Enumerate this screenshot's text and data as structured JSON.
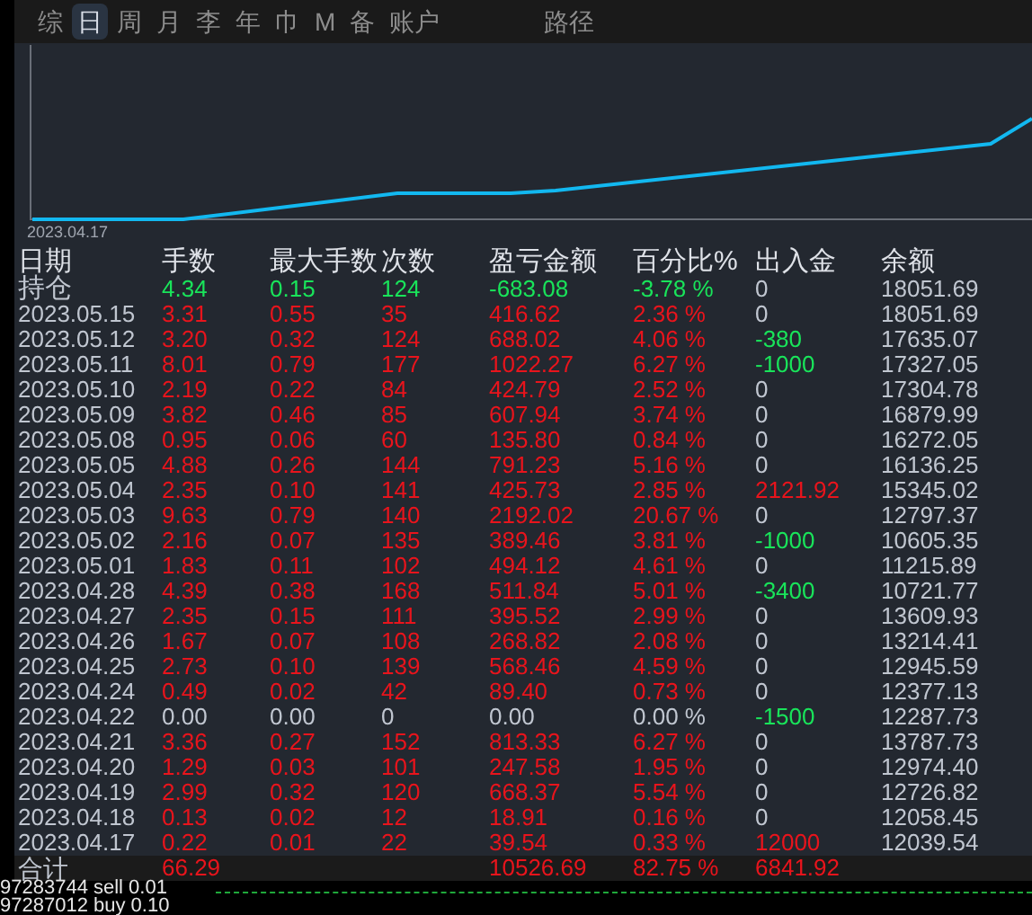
{
  "tabs": [
    {
      "label": "综",
      "selected": false
    },
    {
      "label": "日",
      "selected": true
    },
    {
      "label": "周",
      "selected": false
    },
    {
      "label": "月",
      "selected": false
    },
    {
      "label": "李",
      "selected": false
    },
    {
      "label": "年",
      "selected": false
    },
    {
      "label": "巾",
      "selected": false
    },
    {
      "label": "M",
      "selected": false
    },
    {
      "label": "备",
      "selected": false
    },
    {
      "label": "账户",
      "selected": false
    }
  ],
  "path_tab": {
    "label": "路径",
    "selected": false
  },
  "equity_chart": {
    "start_label": "2023.04.17"
  },
  "table": {
    "columns": [
      "日期",
      "手数",
      "最大手数",
      "次数",
      "盈亏金额",
      "百分比%",
      "出入金",
      "余额"
    ],
    "rows": [
      {
        "date": "持仓",
        "lots": "4.34",
        "max_lots": "0.15",
        "count": "124",
        "pnl": "-683.08",
        "pct": "-3.78 %",
        "flow": {
          "value": "0",
          "color": "#c0c6d0"
        },
        "balance": "18051.69",
        "color": "#19e45a"
      },
      {
        "date": "2023.05.15",
        "lots": "3.31",
        "max_lots": "0.55",
        "count": "35",
        "pnl": "416.62",
        "pct": "2.36 %",
        "flow": {
          "value": "0",
          "color": "#c0c6d0"
        },
        "balance": "18051.69",
        "color": "#e8141c"
      },
      {
        "date": "2023.05.12",
        "lots": "3.20",
        "max_lots": "0.32",
        "count": "124",
        "pnl": "688.02",
        "pct": "4.06 %",
        "flow": {
          "value": "-380",
          "color": "#19e45a"
        },
        "balance": "17635.07",
        "color": "#e8141c"
      },
      {
        "date": "2023.05.11",
        "lots": "8.01",
        "max_lots": "0.79",
        "count": "177",
        "pnl": "1022.27",
        "pct": "6.27 %",
        "flow": {
          "value": "-1000",
          "color": "#19e45a"
        },
        "balance": "17327.05",
        "color": "#e8141c"
      },
      {
        "date": "2023.05.10",
        "lots": "2.19",
        "max_lots": "0.22",
        "count": "84",
        "pnl": "424.79",
        "pct": "2.52 %",
        "flow": {
          "value": "0",
          "color": "#c0c6d0"
        },
        "balance": "17304.78",
        "color": "#e8141c"
      },
      {
        "date": "2023.05.09",
        "lots": "3.82",
        "max_lots": "0.46",
        "count": "85",
        "pnl": "607.94",
        "pct": "3.74 %",
        "flow": {
          "value": "0",
          "color": "#c0c6d0"
        },
        "balance": "16879.99",
        "color": "#e8141c"
      },
      {
        "date": "2023.05.08",
        "lots": "0.95",
        "max_lots": "0.06",
        "count": "60",
        "pnl": "135.80",
        "pct": "0.84 %",
        "flow": {
          "value": "0",
          "color": "#c0c6d0"
        },
        "balance": "16272.05",
        "color": "#e8141c"
      },
      {
        "date": "2023.05.05",
        "lots": "4.88",
        "max_lots": "0.26",
        "count": "144",
        "pnl": "791.23",
        "pct": "5.16 %",
        "flow": {
          "value": "0",
          "color": "#c0c6d0"
        },
        "balance": "16136.25",
        "color": "#e8141c"
      },
      {
        "date": "2023.05.04",
        "lots": "2.35",
        "max_lots": "0.10",
        "count": "141",
        "pnl": "425.73",
        "pct": "2.85 %",
        "flow": {
          "value": "2121.92",
          "color": "#e8141c"
        },
        "balance": "15345.02",
        "color": "#e8141c"
      },
      {
        "date": "2023.05.03",
        "lots": "9.63",
        "max_lots": "0.79",
        "count": "140",
        "pnl": "2192.02",
        "pct": "20.67 %",
        "flow": {
          "value": "0",
          "color": "#c0c6d0"
        },
        "balance": "12797.37",
        "color": "#e8141c"
      },
      {
        "date": "2023.05.02",
        "lots": "2.16",
        "max_lots": "0.07",
        "count": "135",
        "pnl": "389.46",
        "pct": "3.81 %",
        "flow": {
          "value": "-1000",
          "color": "#19e45a"
        },
        "balance": "10605.35",
        "color": "#e8141c"
      },
      {
        "date": "2023.05.01",
        "lots": "1.83",
        "max_lots": "0.11",
        "count": "102",
        "pnl": "494.12",
        "pct": "4.61 %",
        "flow": {
          "value": "0",
          "color": "#c0c6d0"
        },
        "balance": "11215.89",
        "color": "#e8141c"
      },
      {
        "date": "2023.04.28",
        "lots": "4.39",
        "max_lots": "0.38",
        "count": "168",
        "pnl": "511.84",
        "pct": "5.01 %",
        "flow": {
          "value": "-3400",
          "color": "#19e45a"
        },
        "balance": "10721.77",
        "color": "#e8141c"
      },
      {
        "date": "2023.04.27",
        "lots": "2.35",
        "max_lots": "0.15",
        "count": "111",
        "pnl": "395.52",
        "pct": "2.99 %",
        "flow": {
          "value": "0",
          "color": "#c0c6d0"
        },
        "balance": "13609.93",
        "color": "#e8141c"
      },
      {
        "date": "2023.04.26",
        "lots": "1.67",
        "max_lots": "0.07",
        "count": "108",
        "pnl": "268.82",
        "pct": "2.08 %",
        "flow": {
          "value": "0",
          "color": "#c0c6d0"
        },
        "balance": "13214.41",
        "color": "#e8141c"
      },
      {
        "date": "2023.04.25",
        "lots": "2.73",
        "max_lots": "0.10",
        "count": "139",
        "pnl": "568.46",
        "pct": "4.59 %",
        "flow": {
          "value": "0",
          "color": "#c0c6d0"
        },
        "balance": "12945.59",
        "color": "#e8141c"
      },
      {
        "date": "2023.04.24",
        "lots": "0.49",
        "max_lots": "0.02",
        "count": "42",
        "pnl": "89.40",
        "pct": "0.73 %",
        "flow": {
          "value": "0",
          "color": "#c0c6d0"
        },
        "balance": "12377.13",
        "color": "#e8141c"
      },
      {
        "date": "2023.04.22",
        "lots": "0.00",
        "max_lots": "0.00",
        "count": "0",
        "pnl": "0.00",
        "pct": "0.00 %",
        "flow": {
          "value": "-1500",
          "color": "#19e45a"
        },
        "balance": "12287.73",
        "color": "#c0c6d0"
      },
      {
        "date": "2023.04.21",
        "lots": "3.36",
        "max_lots": "0.27",
        "count": "152",
        "pnl": "813.33",
        "pct": "6.27 %",
        "flow": {
          "value": "0",
          "color": "#c0c6d0"
        },
        "balance": "13787.73",
        "color": "#e8141c"
      },
      {
        "date": "2023.04.20",
        "lots": "1.29",
        "max_lots": "0.03",
        "count": "101",
        "pnl": "247.58",
        "pct": "1.95 %",
        "flow": {
          "value": "0",
          "color": "#c0c6d0"
        },
        "balance": "12974.40",
        "color": "#e8141c"
      },
      {
        "date": "2023.04.19",
        "lots": "2.99",
        "max_lots": "0.32",
        "count": "120",
        "pnl": "668.37",
        "pct": "5.54 %",
        "flow": {
          "value": "0",
          "color": "#c0c6d0"
        },
        "balance": "12726.82",
        "color": "#e8141c"
      },
      {
        "date": "2023.04.18",
        "lots": "0.13",
        "max_lots": "0.02",
        "count": "12",
        "pnl": "18.91",
        "pct": "0.16 %",
        "flow": {
          "value": "0",
          "color": "#c0c6d0"
        },
        "balance": "12058.45",
        "color": "#e8141c"
      },
      {
        "date": "2023.04.17",
        "lots": "0.22",
        "max_lots": "0.01",
        "count": "22",
        "pnl": "39.54",
        "pct": "0.33 %",
        "flow": {
          "value": "12000",
          "color": "#e8141c"
        },
        "balance": "12039.54",
        "color": "#e8141c"
      }
    ],
    "total": {
      "label": "合计",
      "lots": "66.29",
      "pnl": "10526.69",
      "pct": "82.75 %",
      "flow": {
        "value": "6841.92",
        "color": "#e8141c"
      },
      "color": "#e8141c"
    }
  },
  "log_lines": [
    "97283744 sell 0.01",
    "97287012 buy 0.10"
  ]
}
